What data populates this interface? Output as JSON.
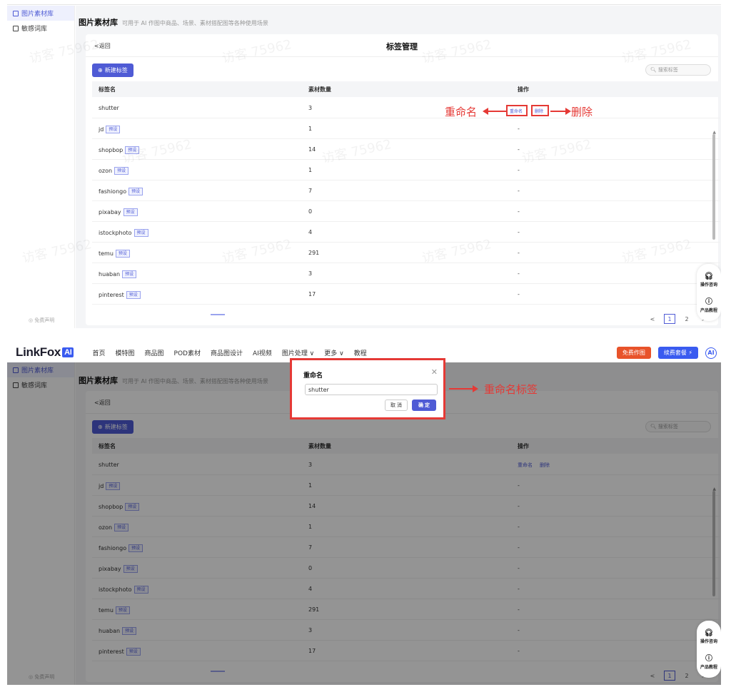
{
  "header": {
    "logo_text": "LinkFox",
    "logo_badge": "AI",
    "nav": [
      "首页",
      "模特图",
      "商品图",
      "POD素材",
      "商品图设计",
      "AI视频",
      "图片处理 ∨",
      "更多 ∨",
      "教程"
    ],
    "free_button": "免费作图",
    "upgrade_button": "续费套餐 ⚡",
    "avatar": "AI"
  },
  "sidebar": {
    "items": [
      {
        "label": "图片素材库",
        "active": true
      },
      {
        "label": "敏感词库",
        "active": false
      }
    ],
    "footer": "◎ 免费声明"
  },
  "page": {
    "title": "图片素材库",
    "subtitle": "可用于 AI 作图中商品、场景、素材搭配图等各种使用场景"
  },
  "card": {
    "back": "<返回",
    "title": "标签管理",
    "new_button": "新建标签",
    "search_placeholder": "搜索标签"
  },
  "table": {
    "headers": [
      "标签名",
      "素材数量",
      "操作"
    ],
    "preset_badge": "预设",
    "rename": "重命名",
    "delete": "删除",
    "rows": [
      {
        "name": "shutter",
        "count": "3",
        "preset": false,
        "op": ""
      },
      {
        "name": "jd",
        "count": "1",
        "preset": true,
        "op": "-"
      },
      {
        "name": "shopbop",
        "count": "14",
        "preset": true,
        "op": "-"
      },
      {
        "name": "ozon",
        "count": "1",
        "preset": true,
        "op": "-"
      },
      {
        "name": "fashiongo",
        "count": "7",
        "preset": true,
        "op": "-"
      },
      {
        "name": "pixabay",
        "count": "0",
        "preset": true,
        "op": "-"
      },
      {
        "name": "istockphoto",
        "count": "4",
        "preset": true,
        "op": "-"
      },
      {
        "name": "temu",
        "count": "291",
        "preset": true,
        "op": "-"
      },
      {
        "name": "huaban",
        "count": "3",
        "preset": true,
        "op": "-"
      },
      {
        "name": "pinterest",
        "count": "17",
        "preset": true,
        "op": "-"
      }
    ]
  },
  "pager": {
    "prev": "<",
    "current": "1",
    "next_page": "2",
    "next": ">"
  },
  "float_help": {
    "consult": "操作咨询",
    "tutorial": "产品教程"
  },
  "watermark": "访客 75962",
  "annotations": {
    "rename": "重命名",
    "delete": "删除",
    "rename_tag": "重命名标签"
  },
  "dialog": {
    "title": "重命名",
    "value": "shutter",
    "cancel": "取 消",
    "ok": "确 定"
  }
}
